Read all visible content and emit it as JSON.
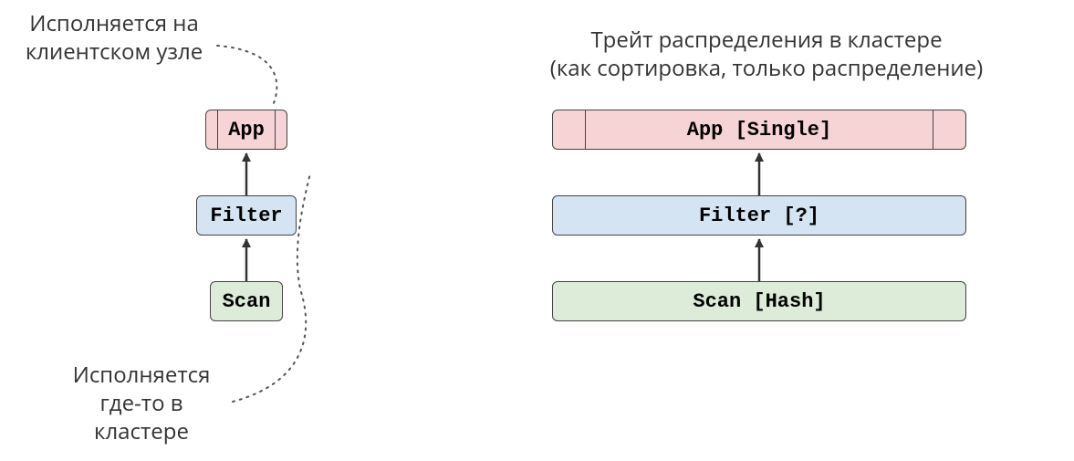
{
  "left": {
    "annotation_top_line1": "Исполняется на",
    "annotation_top_line2": "клиентском узле",
    "annotation_bottom_line1": "Исполняется",
    "annotation_bottom_line2": "где-то в",
    "annotation_bottom_line3": "кластере",
    "nodes": {
      "app": "App",
      "filter": "Filter",
      "scan": "Scan"
    }
  },
  "right": {
    "title_line1": "Трейт распределения в кластере",
    "title_line2": "(как сортировка, только распределение)",
    "nodes": {
      "app": "App [Single]",
      "filter": "Filter [?]",
      "scan": "Scan [Hash]"
    }
  },
  "colors": {
    "pink": "#f6d4d6",
    "blue": "#d5e4f2",
    "green": "#dcecd8",
    "border": "#444444",
    "text": "#333333"
  }
}
